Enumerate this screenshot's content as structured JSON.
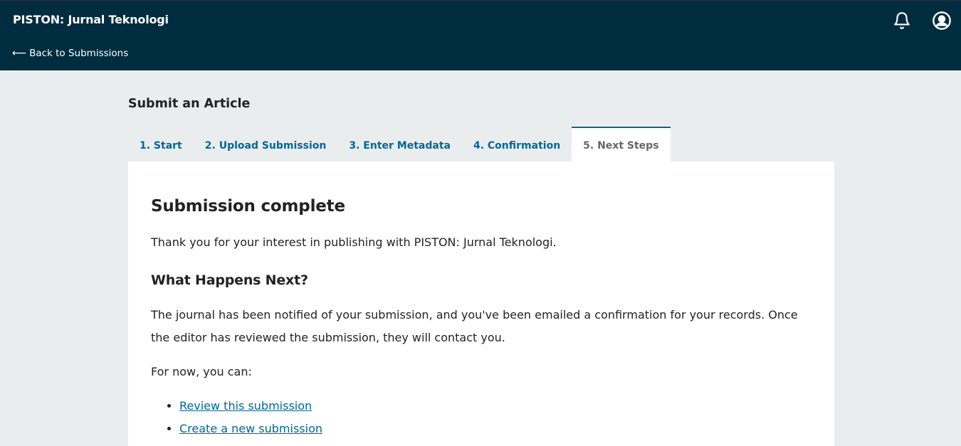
{
  "header": {
    "site_title": "PISTON: Jurnal Teknologi",
    "back_label": "Back to Submissions",
    "notifications_icon": "bell-icon",
    "user_icon": "user-circle-icon"
  },
  "page": {
    "heading": "Submit an Article"
  },
  "tabs": [
    {
      "label": "1. Start"
    },
    {
      "label": "2. Upload Submission"
    },
    {
      "label": "3. Enter Metadata"
    },
    {
      "label": "4. Confirmation"
    },
    {
      "label": "5. Next Steps",
      "active": true
    }
  ],
  "content": {
    "title": "Submission complete",
    "thanks": "Thank you for your interest in publishing with PISTON: Jurnal Teknologi.",
    "next_heading": "What Happens Next?",
    "next_body": "The journal has been notified of your submission, and you've been emailed a confirmation for your records. Once the editor has reviewed the submission, they will contact you.",
    "for_now": "For now, you can:",
    "links": [
      {
        "label": "Review this submission"
      },
      {
        "label": "Create a new submission"
      }
    ]
  },
  "colors": {
    "header_bg": "#002c3f",
    "accent": "#006798",
    "page_bg": "#eaedee"
  }
}
